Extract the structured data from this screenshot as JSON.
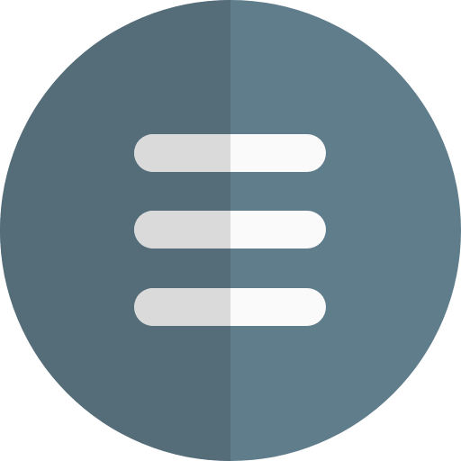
{
  "icon": {
    "name": "hamburger-menu-icon",
    "colors": {
      "circle_light": "#607d8b",
      "circle_dark": "#546d79",
      "bar_light": "#fafafa",
      "bar_dark": "#dadada"
    }
  }
}
